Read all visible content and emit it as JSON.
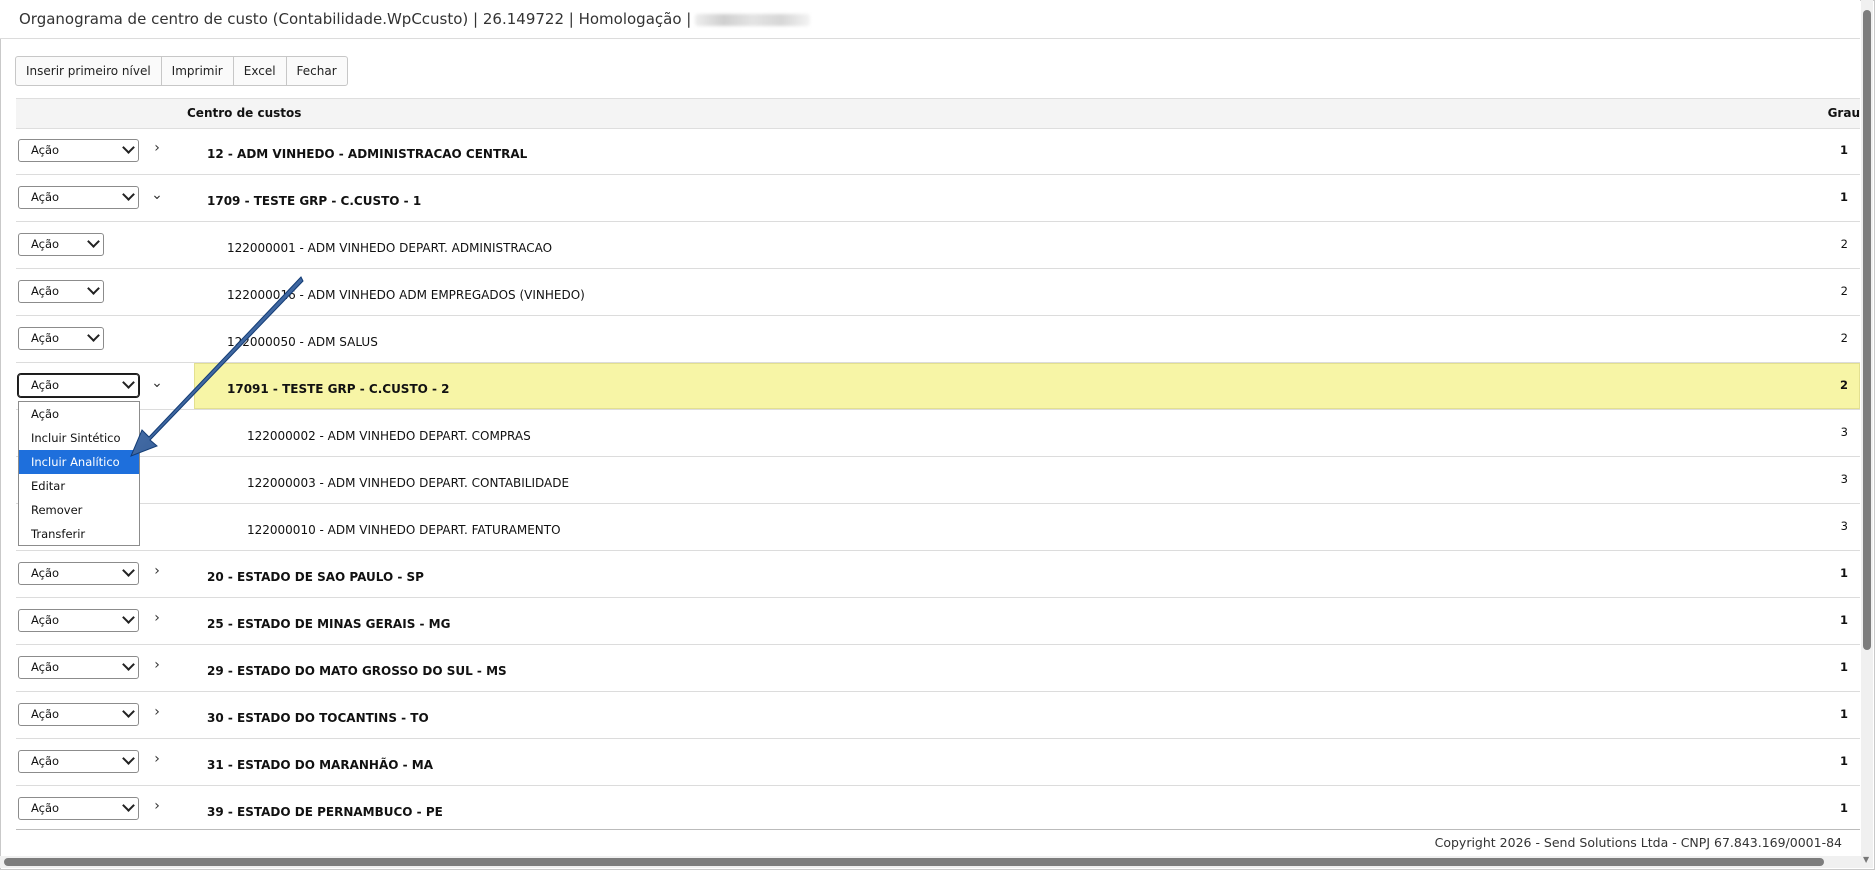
{
  "window": {
    "title": "Organograma de centro de custo (Contabilidade.WpCcusto) | 26.149722 | Homologação |"
  },
  "toolbar": {
    "buttons": [
      "Inserir primeiro nível",
      "Imprimir",
      "Excel",
      "Fechar"
    ]
  },
  "table": {
    "headers": {
      "name": "Centro de custos",
      "grau": "Grau"
    },
    "action_label": "Ação",
    "rows": [
      {
        "label": "12 - ADM VINHEDO - ADMINISTRACAO CENTRAL",
        "grau": "1",
        "toggle": "›"
      },
      {
        "label": "1709 - TESTE GRP - C.CUSTO - 1",
        "grau": "1",
        "toggle": "⌄"
      },
      {
        "label": "122000001 - ADM VINHEDO DEPART. ADMINISTRACAO",
        "grau": "2"
      },
      {
        "label": "122000016 - ADM VINHEDO ADM EMPREGADOS (VINHEDO)",
        "grau": "2"
      },
      {
        "label": "122000050 - ADM SALUS",
        "grau": "2"
      },
      {
        "label": "17091 - TESTE GRP - C.CUSTO - 2",
        "grau": "2",
        "toggle": "⌄"
      },
      {
        "label": "122000002 - ADM VINHEDO DEPART. COMPRAS",
        "grau": "3"
      },
      {
        "label": "122000003 - ADM VINHEDO DEPART. CONTABILIDADE",
        "grau": "3"
      },
      {
        "label": "122000010 - ADM VINHEDO DEPART. FATURAMENTO",
        "grau": "3"
      },
      {
        "label": "20 - ESTADO DE SAO PAULO - SP",
        "grau": "1",
        "toggle": "›"
      },
      {
        "label": "25 - ESTADO DE MINAS GERAIS - MG",
        "grau": "1",
        "toggle": "›"
      },
      {
        "label": "29 - ESTADO DO MATO GROSSO DO SUL - MS",
        "grau": "1",
        "toggle": "›"
      },
      {
        "label": "30 - ESTADO DO TOCANTINS - TO",
        "grau": "1",
        "toggle": "›"
      },
      {
        "label": "31 - ESTADO DO MARANHÃO - MA",
        "grau": "1",
        "toggle": "›"
      },
      {
        "label": "39 - ESTADO DE PERNAMBUCO - PE",
        "grau": "1",
        "toggle": "›"
      }
    ]
  },
  "dropdown": {
    "options": [
      "Ação",
      "Incluir Sintético",
      "Incluir Analítico",
      "Editar",
      "Remover",
      "Transferir"
    ],
    "highlighted": "Incluir Analítico"
  },
  "footer": {
    "copyright": "Copyright 2026 - Send Solutions Ltda - CNPJ 67.843.169/0001-84"
  },
  "colors": {
    "selected_row": "#f7f5a6",
    "dropdown_highlight": "#1e6fdc",
    "annotation_arrow": "#1f4f8f"
  }
}
